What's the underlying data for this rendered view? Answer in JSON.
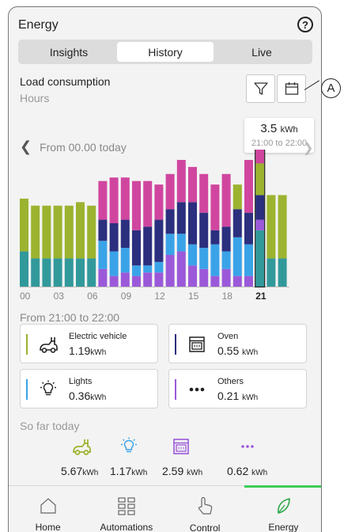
{
  "header": {
    "title": "Energy",
    "help": "?"
  },
  "tabs": [
    {
      "label": "Insights",
      "active": false
    },
    {
      "label": "History",
      "active": true
    },
    {
      "label": "Live",
      "active": false
    }
  ],
  "section": {
    "title": "Load consumption",
    "subtitle": "Hours"
  },
  "toolbar": {
    "filter_icon": "filter-icon",
    "calendar_icon": "calendar-icon"
  },
  "callout": {
    "label": "A"
  },
  "tooltip": {
    "value": "3.5",
    "unit": "kWh",
    "range": "21:00 to 22:00"
  },
  "chart_nav": {
    "label": "From 00.00 today"
  },
  "chart_data": {
    "type": "bar",
    "stacked": true,
    "x_ticks": [
      "00",
      "03",
      "06",
      "09",
      "12",
      "15",
      "18",
      "21"
    ],
    "selected_tick": "21",
    "selected_index": 21,
    "colors": {
      "Others": "#9b59d9",
      "Lights": "#3aa3e8",
      "Oven": "#2b2f7e",
      "Electric vehicle": "#9bb32f",
      "Base": "#32999b",
      "Pink": "#d0469f"
    },
    "series": [
      {
        "name": "",
        "color": "#32999b",
        "values": [
          1.0,
          0.8,
          0.8,
          0.8,
          0.8,
          0.8,
          0.8,
          0,
          0,
          0,
          0,
          0,
          0,
          0,
          0,
          0,
          0,
          0,
          0,
          0,
          0,
          1.6,
          0.8,
          0.8
        ]
      },
      {
        "name": "",
        "color": "#9b59d9",
        "values": [
          0,
          0,
          0,
          0,
          0,
          0,
          0,
          0.5,
          0.3,
          0.4,
          0.3,
          0.4,
          0.4,
          0.9,
          1.0,
          0.6,
          0.5,
          0.3,
          0.5,
          0.3,
          0.3,
          0.3,
          0,
          0
        ]
      },
      {
        "name": "",
        "color": "#3aa3e8",
        "values": [
          0,
          0,
          0,
          0,
          0,
          0,
          0,
          0.8,
          0.7,
          0.7,
          0.3,
          0.2,
          0.3,
          0.6,
          0.5,
          0.6,
          0.6,
          0.9,
          0.5,
          1.1,
          0.9,
          0,
          0,
          0
        ]
      },
      {
        "name": "",
        "color": "#2b2f7e",
        "values": [
          0,
          0,
          0,
          0,
          0,
          0,
          0,
          0.6,
          0.8,
          0.8,
          1.0,
          1.1,
          1.2,
          0.7,
          0.9,
          1.2,
          1.0,
          0.4,
          0.7,
          0.8,
          0.9,
          0.7,
          0,
          0
        ]
      },
      {
        "name": "",
        "color": "#9bb32f",
        "values": [
          1.5,
          1.5,
          1.5,
          1.5,
          1.5,
          1.6,
          1.5,
          0,
          0,
          0,
          0,
          0,
          0,
          0,
          0,
          0,
          0,
          0,
          0,
          0.7,
          0,
          0.9,
          1.8,
          1.8
        ]
      },
      {
        "name": "",
        "color": "#d0469f",
        "values": [
          0,
          0,
          0,
          0,
          0,
          0,
          0,
          1.1,
          1.3,
          1.2,
          1.4,
          1.3,
          1.0,
          1.0,
          1.2,
          1.0,
          1.1,
          1.3,
          1.5,
          0,
          1.5,
          0.6,
          0,
          0
        ]
      }
    ],
    "ylim": [
      0,
      3.6
    ],
    "grid": false
  },
  "range_label": "From 21:00 to 22:00",
  "cards": [
    {
      "name": "Electric vehicle",
      "value": "1.19",
      "unit": "kWh",
      "color": "#9bb32f",
      "icon": "ev-charger-icon"
    },
    {
      "name": "Oven",
      "value": "0.55",
      "unit": "kWh",
      "color": "#2b2f7e",
      "icon": "oven-icon"
    },
    {
      "name": "Lights",
      "value": "0.36",
      "unit": "kWh",
      "color": "#3aa3e8",
      "icon": "lightbulb-icon"
    },
    {
      "name": "Others",
      "value": "0.21",
      "unit": "kWh",
      "color": "#9b59d9",
      "icon": "more-dots-icon"
    }
  ],
  "so_far": {
    "label": "So far today",
    "items": [
      {
        "value": "5.67",
        "unit": "kWh",
        "icon": "ev-charger-icon",
        "color": "#9bb32f"
      },
      {
        "value": "1.17",
        "unit": "kWh",
        "icon": "lightbulb-icon",
        "color": "#3aa3e8"
      },
      {
        "value": "2.59",
        "unit": "kWh",
        "icon": "oven-icon",
        "color": "#9b59d9"
      },
      {
        "value": "0.62",
        "unit": "kWh",
        "icon": "more-dots-icon",
        "color": "#9b59d9"
      }
    ]
  },
  "bottom_nav": [
    {
      "label": "Home",
      "icon": "home-icon",
      "active": false
    },
    {
      "label": "Automations",
      "icon": "grid-icon",
      "active": false
    },
    {
      "label": "Control",
      "icon": "touch-icon",
      "active": false
    },
    {
      "label": "Energy",
      "icon": "leaf-icon",
      "active": true
    }
  ],
  "accent": "#3dcd58"
}
